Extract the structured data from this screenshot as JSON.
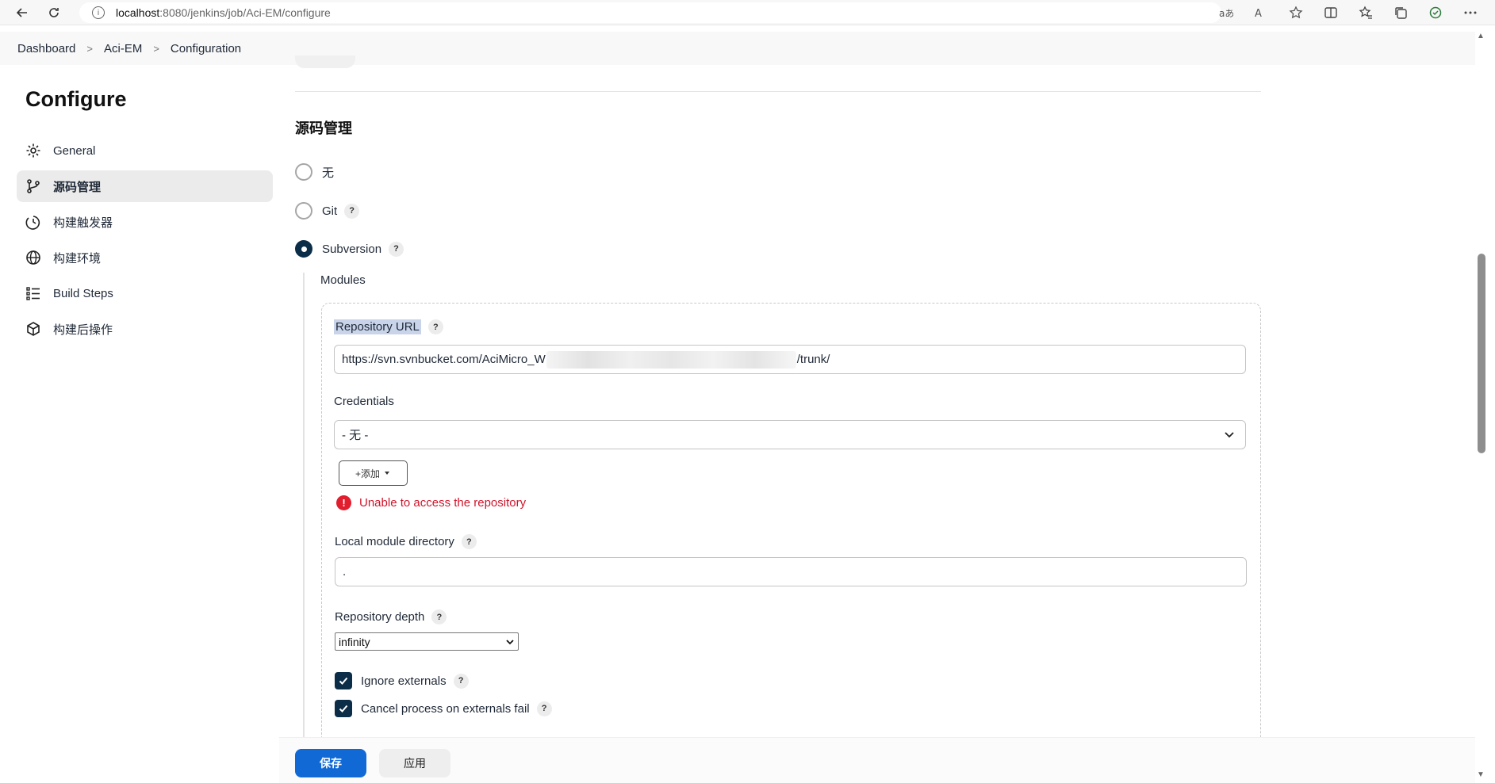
{
  "browser": {
    "url_host": "localhost",
    "url_path": ":8080/jenkins/job/Aci-EM/configure"
  },
  "breadcrumb": [
    "Dashboard",
    "Aci-EM",
    "Configuration"
  ],
  "sidebar": {
    "title": "Configure",
    "items": [
      {
        "label": "General",
        "icon": "gear-icon"
      },
      {
        "label": "源码管理",
        "icon": "branch-icon"
      },
      {
        "label": "构建触发器",
        "icon": "clock-icon"
      },
      {
        "label": "构建环境",
        "icon": "globe-icon"
      },
      {
        "label": "Build Steps",
        "icon": "list-icon"
      },
      {
        "label": "构建后操作",
        "icon": "cube-icon"
      }
    ],
    "active_index": 1
  },
  "scm": {
    "section_title": "源码管理",
    "options": [
      {
        "label": "无",
        "checked": false,
        "help": false
      },
      {
        "label": "Git",
        "checked": false,
        "help": true
      },
      {
        "label": "Subversion",
        "checked": true,
        "help": true
      }
    ],
    "modules_label": "Modules",
    "repo_url_label": "Repository URL",
    "repo_url_prefix": "https://svn.svnbucket.com/AciMicro_W",
    "repo_url_suffix": "/trunk/",
    "credentials_label": "Credentials",
    "credentials_value": "- 无 -",
    "add_button": "+添加",
    "error_text": "Unable to access the repository",
    "local_dir_label": "Local module directory",
    "local_dir_value": ".",
    "depth_label": "Repository depth",
    "depth_value": "infinity",
    "ignore_externals": "Ignore externals",
    "cancel_process": "Cancel process on externals fail"
  },
  "footer": {
    "save": "保存",
    "apply": "应用"
  },
  "colors": {
    "primary": "#1169d6",
    "dark": "#0c2d48",
    "error": "#d0152b"
  }
}
